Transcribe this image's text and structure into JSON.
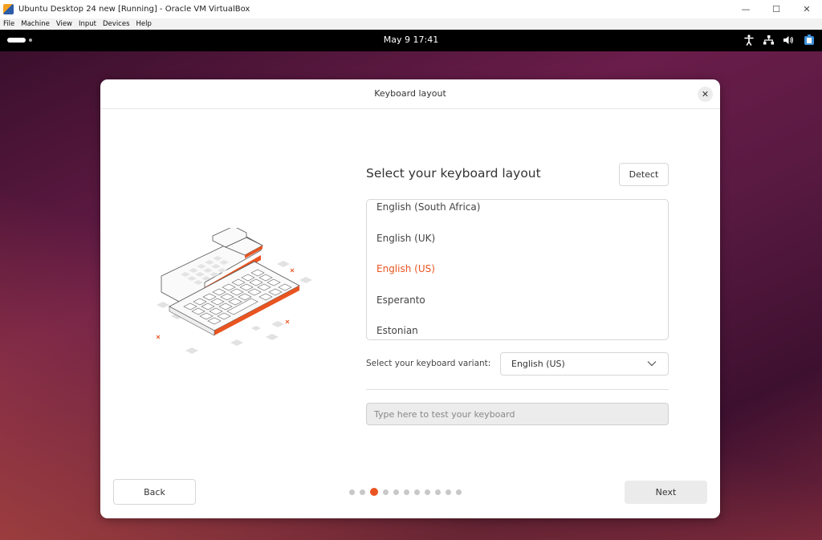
{
  "host_window": {
    "title": "Ubuntu Desktop 24 new [Running] - Oracle VM VirtualBox",
    "controls": {
      "minimize": "—",
      "maximize": "☐",
      "close": "✕"
    },
    "menu": [
      "File",
      "Machine",
      "View",
      "Input",
      "Devices",
      "Help"
    ]
  },
  "guest_topbar": {
    "clock": "May 9  17:41",
    "tray_icons": [
      "accessibility-icon",
      "network-icon",
      "volume-icon",
      "battery-icon"
    ]
  },
  "dialog": {
    "title": "Keyboard layout",
    "close_label": "✕",
    "heading": "Select your keyboard layout",
    "detect_label": "Detect",
    "layouts": [
      {
        "label": "English (South Africa)",
        "selected": false
      },
      {
        "label": "English (UK)",
        "selected": false
      },
      {
        "label": "English (US)",
        "selected": true
      },
      {
        "label": "Esperanto",
        "selected": false
      },
      {
        "label": "Estonian",
        "selected": false
      }
    ],
    "variant_label": "Select your keyboard variant:",
    "variant_value": "English (US)",
    "test_placeholder": "Type here to test your keyboard",
    "back_label": "Back",
    "next_label": "Next",
    "progress": {
      "total": 11,
      "current": 3
    }
  },
  "colors": {
    "accent": "#e95420",
    "topbar": "#000000"
  }
}
